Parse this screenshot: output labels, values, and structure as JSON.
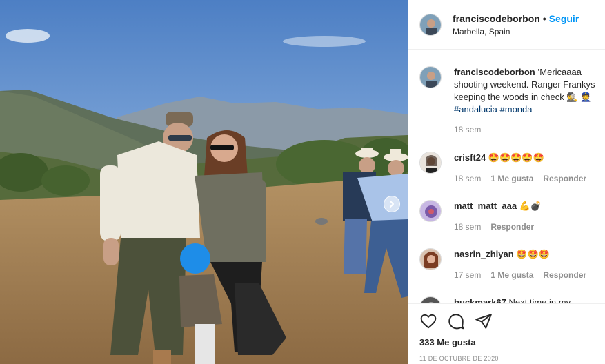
{
  "post": {
    "username": "franciscodeborbon",
    "follow_label": "Seguir",
    "dot": "•",
    "location": "Marbella, Spain"
  },
  "caption": {
    "username": "franciscodeborbon",
    "text": "’Mericaaaa shooting weekend. Ranger Frankys keeping the woods in check 🕵️ 👮",
    "tags": [
      "#andalucia",
      "#monda"
    ],
    "time": "18 sem"
  },
  "comments": [
    {
      "username": "crisft24",
      "text": "🤩🤩🤩🤩🤩",
      "time": "18 sem",
      "likes": "1 Me gusta",
      "reply": "Responder"
    },
    {
      "username": "matt_matt_aaa",
      "text": "💪💣",
      "time": "18 sem",
      "likes": "",
      "reply": "Responder"
    },
    {
      "username": "nasrin_zhiyan",
      "text": "🤩🤩🤩",
      "time": "17 sem",
      "likes": "1 Me gusta",
      "reply": "Responder"
    },
    {
      "username": "buckmark67",
      "text": "Next time in my",
      "time": "",
      "likes": "",
      "reply": ""
    }
  ],
  "footer": {
    "likes": "333 Me gusta",
    "date": "11 de octubre de 2020"
  },
  "icons": {
    "like": "heart-icon",
    "comment": "comment-icon",
    "share": "paper-plane-icon",
    "next": "chevron-right-icon"
  }
}
